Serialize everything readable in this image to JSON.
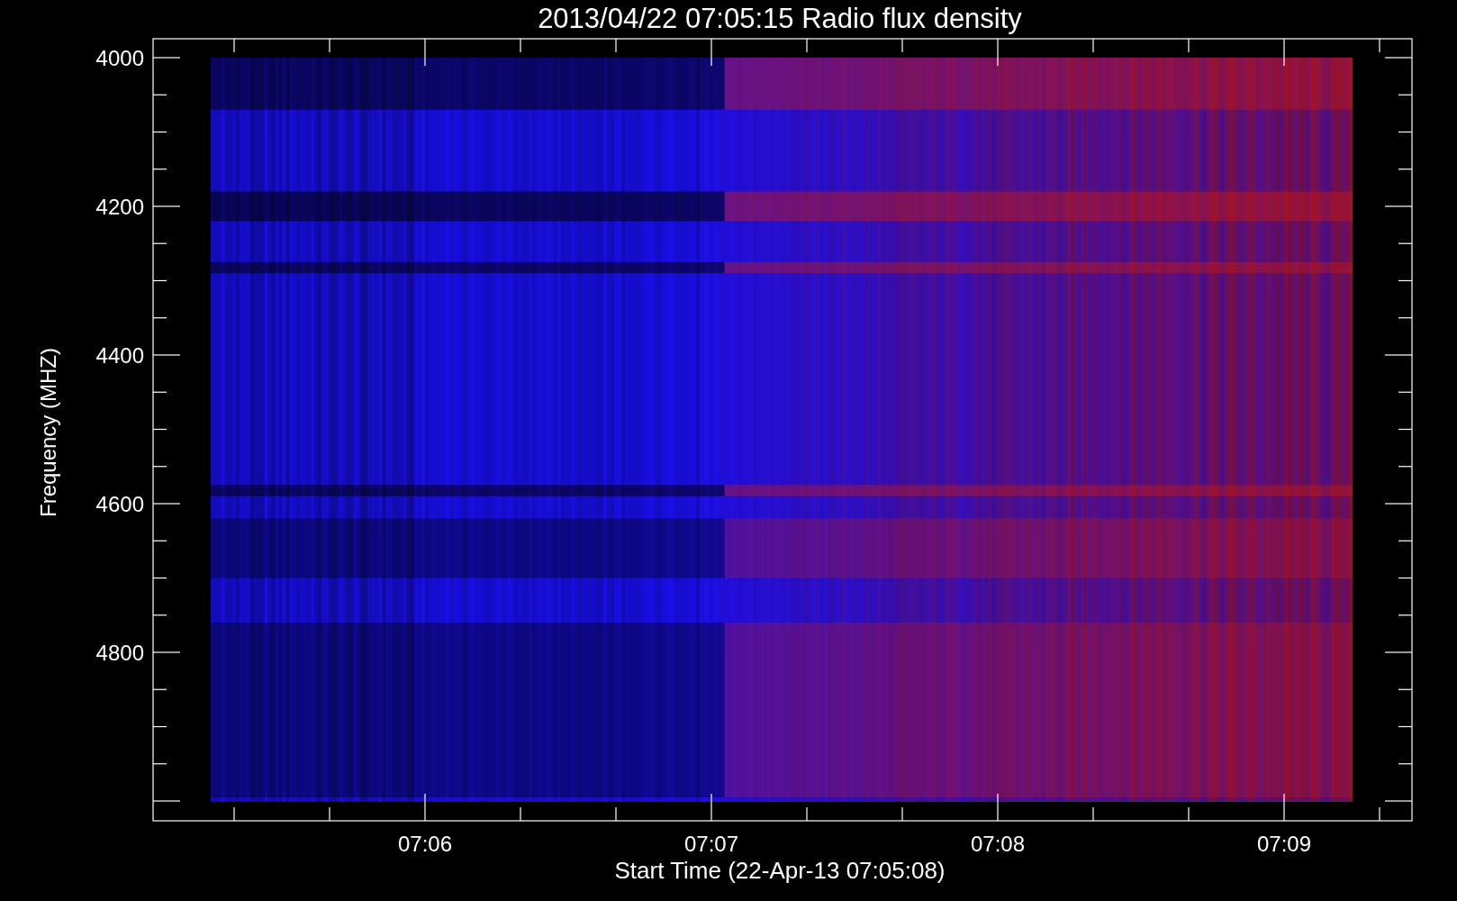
{
  "title": "2013/04/22 07:05:15 Radio flux density",
  "xlabel": "Start Time (22-Apr-13 07:05:08)",
  "ylabel": "Frequency (MHZ)",
  "xtick_labels": [
    "07:06",
    "07:07",
    "07:08",
    "07:09"
  ],
  "ytick_labels": [
    "4000",
    "4200",
    "4400",
    "4600",
    "4800"
  ]
}
